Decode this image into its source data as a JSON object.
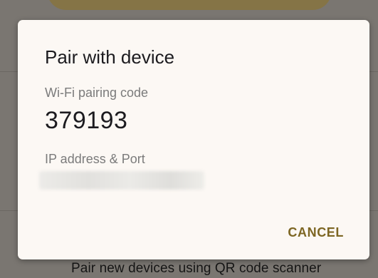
{
  "background": {
    "bottom_text": "Pair new devices using QR code scanner"
  },
  "dialog": {
    "title": "Pair with device",
    "pairing_code_label": "Wi-Fi pairing code",
    "pairing_code": "379193",
    "ip_label": "IP address & Port",
    "ip_value": "",
    "cancel_label": "CANCEL"
  },
  "colors": {
    "scrim": "#7a7671",
    "dialog_bg": "#fcf8f4",
    "accent": "#7d6623",
    "top_pill": "#857446"
  }
}
